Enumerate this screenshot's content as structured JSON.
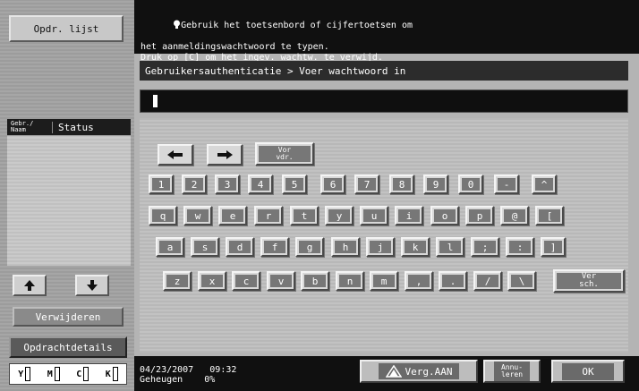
{
  "left_panel": {
    "job_list_label": "Opdr. lijst",
    "status_header_small": "Gebr./\nNaam",
    "status_header_label": "Status",
    "delete_label": "Verwijderen",
    "details_label": "Opdrachtdetails",
    "toner": [
      "Y",
      "M",
      "C",
      "K"
    ]
  },
  "message": {
    "line1": "Gebruik het toetsenbord of cijfertoetsen om",
    "line2": "het aanmeldingswachtwoord te typen.",
    "line3": "Druk op [C] om het ingev. wachtw. te verwijd."
  },
  "breadcrumb": "Gebruikersauthenticatie > Voer wachtwoord in",
  "password_value": "",
  "keyboard": {
    "prev_char_label": "Vor\nvdr.",
    "rows": [
      [
        "1",
        "2",
        "3",
        "4",
        "5",
        "6",
        "7",
        "8",
        "9",
        "0",
        "-",
        "^"
      ],
      [
        "q",
        "w",
        "e",
        "r",
        "t",
        "y",
        "u",
        "i",
        "o",
        "p",
        "@",
        "["
      ],
      [
        "a",
        "s",
        "d",
        "f",
        "g",
        "h",
        "j",
        "k",
        "l",
        ";",
        ":",
        "]"
      ],
      [
        "z",
        "x",
        "c",
        "v",
        "b",
        "n",
        "m",
        ",",
        ".",
        "/",
        "\\"
      ]
    ],
    "shift_label": "Ver\nsch."
  },
  "footer": {
    "date": "04/23/2007",
    "time": "09:32",
    "memory_label": "Geheugen",
    "memory_value": "0%",
    "enlarge_label": "Verg.AAN",
    "cancel_label": "Annu-\nleren",
    "ok_label": "OK"
  }
}
